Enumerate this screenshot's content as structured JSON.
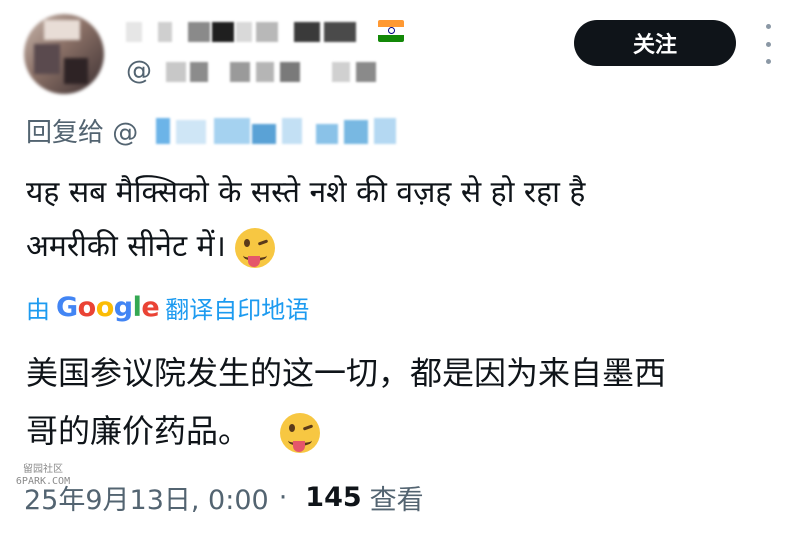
{
  "author": {
    "handle_prefix": "@",
    "flag_icon": "india-flag-icon"
  },
  "actions": {
    "follow_label": "关注",
    "more_icon": "more-vertical-icon"
  },
  "reply": {
    "label": "回复给 @"
  },
  "tweet": {
    "text_line1": "यह सब मैक्सिको के सस्ते नशे की वज़ह से हो रहा है",
    "text_line2": "अमरीकी सीनेट में।",
    "emoji": "winking-face-with-tongue"
  },
  "translation": {
    "prefix": "由",
    "provider": "Google",
    "suffix": "翻译自印地语",
    "text_line1": "美国参议院发生的这一切，都是因为来自墨西",
    "text_line2": "哥的廉价药品。",
    "emoji": "winking-face-with-tongue"
  },
  "watermark": {
    "line1": "留园社区",
    "line2": "6PARK.COM"
  },
  "meta": {
    "date": "25年9月13日, 0:00",
    "separator": "·",
    "views_count": "145",
    "views_label": "查看"
  },
  "colors": {
    "text": "#0f1419",
    "secondary": "#536471",
    "link": "#1d9bf0",
    "button_bg": "#0f1419",
    "google_blue": "#4285f4",
    "google_red": "#ea4335",
    "google_yellow": "#fbbc05",
    "google_green": "#34a853"
  }
}
